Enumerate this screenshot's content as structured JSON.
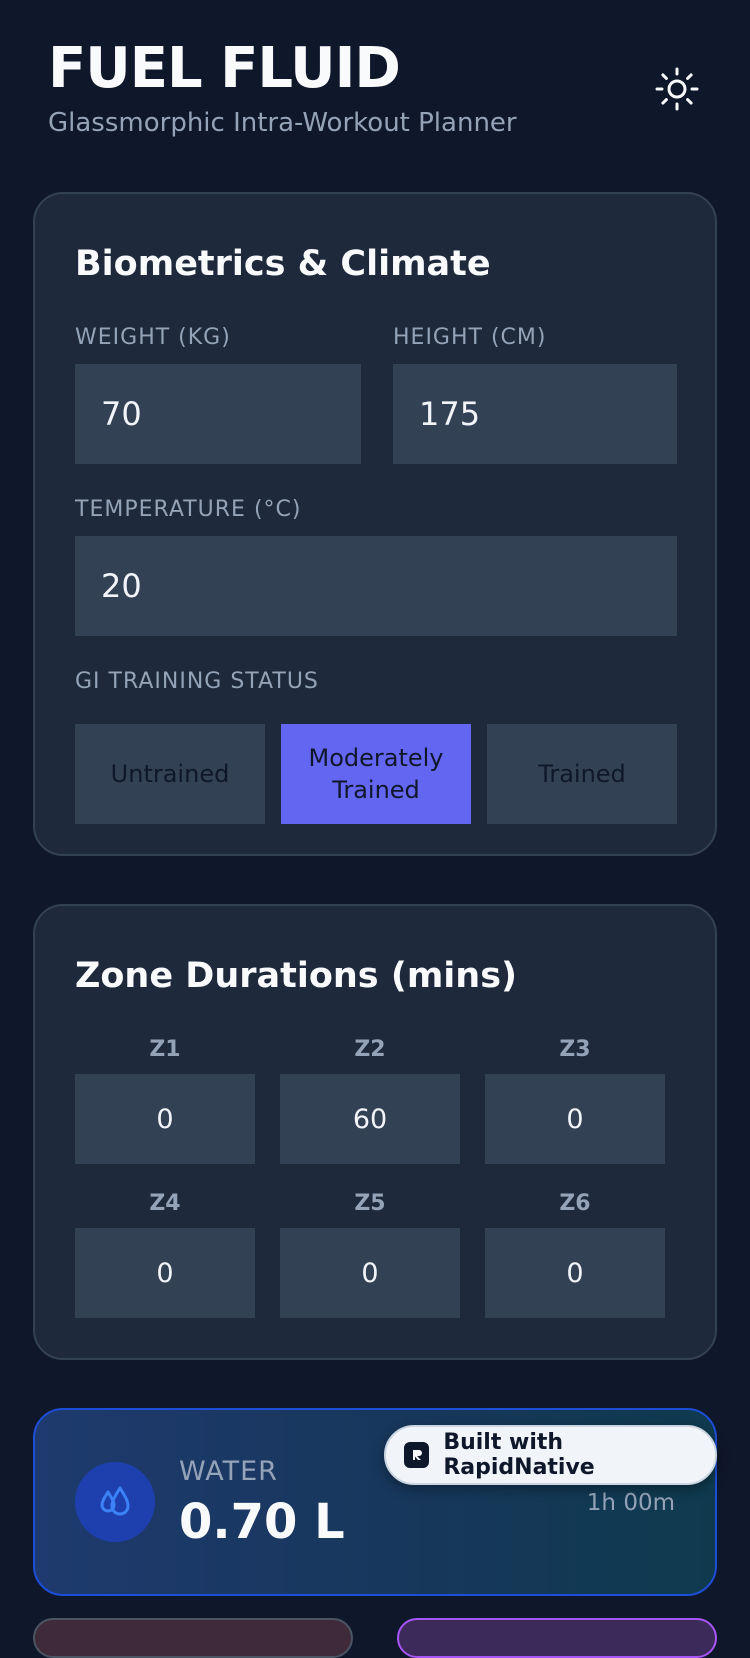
{
  "header": {
    "title": "FUEL FLUID",
    "subtitle": "Glassmorphic Intra-Workout Planner",
    "theme_icon": "sun-icon"
  },
  "biometrics": {
    "title": "Biometrics & Climate",
    "weight": {
      "label": "WEIGHT (KG)",
      "value": "70"
    },
    "height": {
      "label": "HEIGHT (CM)",
      "value": "175"
    },
    "temperature": {
      "label": "TEMPERATURE (°C)",
      "value": "20"
    },
    "gi_status": {
      "label": "GI TRAINING STATUS",
      "options": [
        "Untrained",
        "Moderately Trained",
        "Trained"
      ],
      "selected": "Moderately Trained"
    }
  },
  "zones": {
    "title": "Zone Durations (mins)",
    "items": [
      {
        "label": "Z1",
        "value": "0"
      },
      {
        "label": "Z2",
        "value": "60"
      },
      {
        "label": "Z3",
        "value": "0"
      },
      {
        "label": "Z4",
        "value": "0"
      },
      {
        "label": "Z5",
        "value": "0"
      },
      {
        "label": "Z6",
        "value": "0"
      }
    ]
  },
  "water": {
    "label": "WATER",
    "value": "0.70 L",
    "duration": "1h 00m",
    "icon": "water-drops-icon"
  },
  "badge": {
    "text": "Built with RapidNative",
    "icon": "rapidnative-logo-icon"
  },
  "colors": {
    "background": "#0f172a",
    "card": "#1e293b",
    "input": "#334155",
    "accent": "#6366f1",
    "water_accent": "#3b82f6"
  }
}
